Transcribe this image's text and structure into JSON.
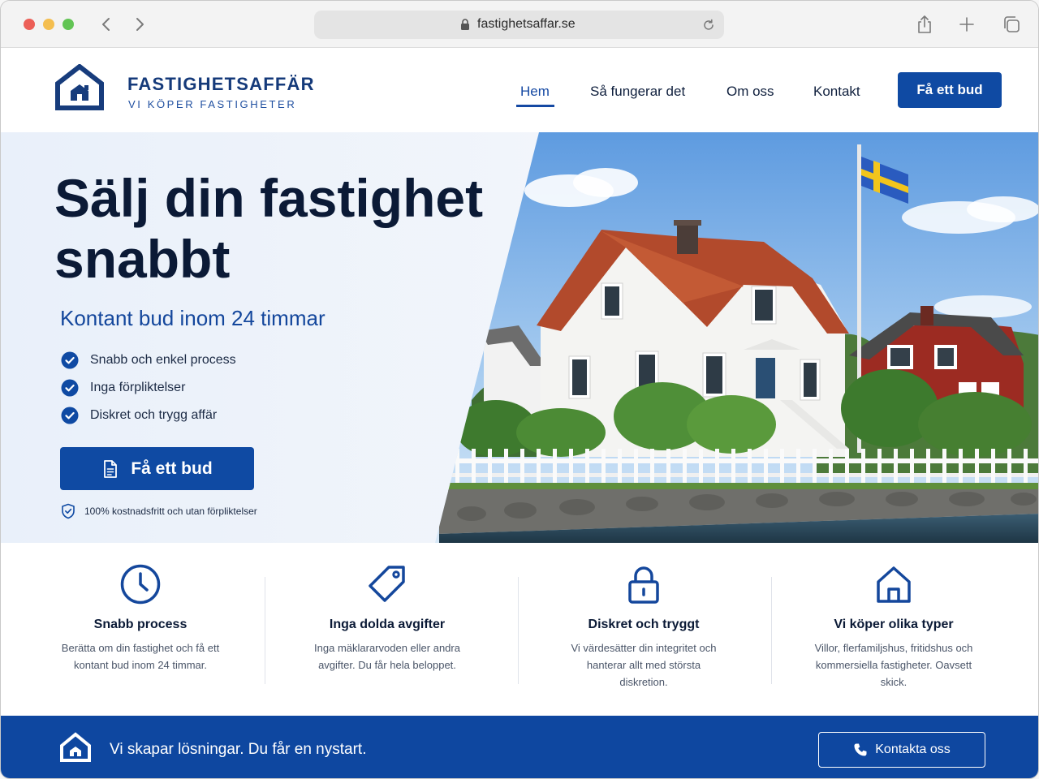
{
  "browser": {
    "url": "fastighetsaffar.se",
    "icons": [
      "back-arrow-icon",
      "forward-arrow-icon",
      "lock-icon",
      "reload-icon",
      "share-icon",
      "new-tab-icon",
      "tabs-overview-icon"
    ]
  },
  "header": {
    "logo_name": "FASTIGHETSAFFÄR",
    "logo_tagline": "VI KÖPER FASTIGHETER",
    "nav": [
      {
        "label": "Hem",
        "active": true
      },
      {
        "label": "Så fungerar det",
        "active": false
      },
      {
        "label": "Om oss",
        "active": false
      },
      {
        "label": "Kontakt",
        "active": false
      }
    ],
    "cta": "Få ett bud"
  },
  "hero": {
    "title": "Sälj din fastighet snabbt",
    "subtitle": "Kontant bud inom 24 timmar",
    "checks": [
      "Snabb och enkel process",
      "Inga förpliktelser",
      "Diskret och trygg affär"
    ],
    "cta": "Få ett bud",
    "note": "100% kostnadsfritt och utan förpliktelser"
  },
  "features": [
    {
      "icon": "clock-icon",
      "title": "Snabb process",
      "text": "Berätta om din fastighet och få ett kontant bud inom 24 timmar."
    },
    {
      "icon": "tag-icon",
      "title": "Inga dolda avgifter",
      "text": "Inga mäklararvoden eller andra avgifter. Du får hela beloppet."
    },
    {
      "icon": "lock-icon",
      "title": "Diskret och tryggt",
      "text": "Vi värdesätter din integritet och hanterar allt med största diskretion."
    },
    {
      "icon": "house-icon",
      "title": "Vi köper olika typer",
      "text": "Villor, flerfamiljshus, fritidshus och kommersiella fastigheter. Oavsett skick."
    }
  ],
  "band": {
    "text": "Vi skapar lösningar. Du får en nystart.",
    "button": "Kontakta oss"
  },
  "colors": {
    "brand_blue": "#0f4aa3",
    "heading_navy": "#0b1a36",
    "hero_background": "#e9f0fa"
  }
}
